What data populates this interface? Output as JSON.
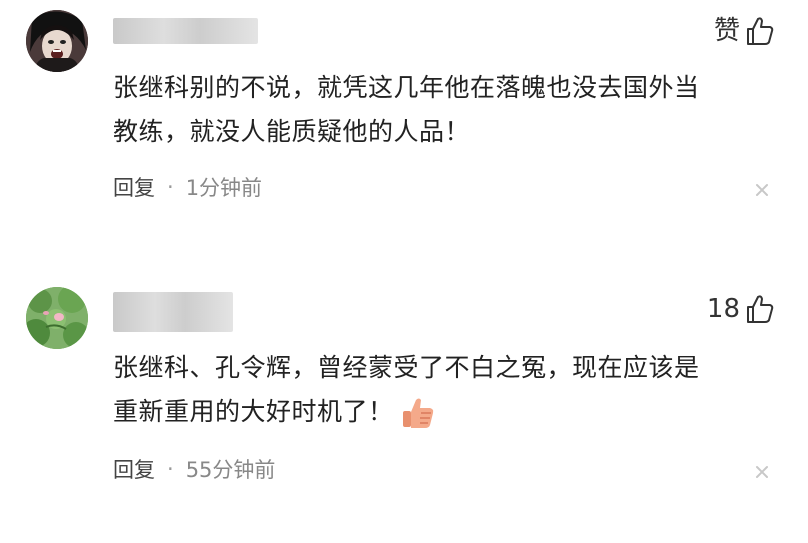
{
  "comments": [
    {
      "like_label": "赞",
      "lines": [
        "张继科别的不说，就凭这几年他在落魄也没去国外当",
        "教练，就没人能质疑他的人品！"
      ],
      "reply_label": "回复",
      "separator": "·",
      "time": "1分钟前"
    },
    {
      "like_label": "18",
      "lines": [
        "张继科、孔令辉，曾经蒙受了不白之冤，现在应该是",
        "重新重用的大好时机了！"
      ],
      "emoji": "thumbs-up-emoji",
      "reply_label": "回复",
      "separator": "·",
      "time": "55分钟前"
    }
  ],
  "icons": {
    "like": "thumb-up-icon",
    "close": "close-icon"
  },
  "colors": {
    "text": "#222222",
    "meta": "#888888"
  }
}
